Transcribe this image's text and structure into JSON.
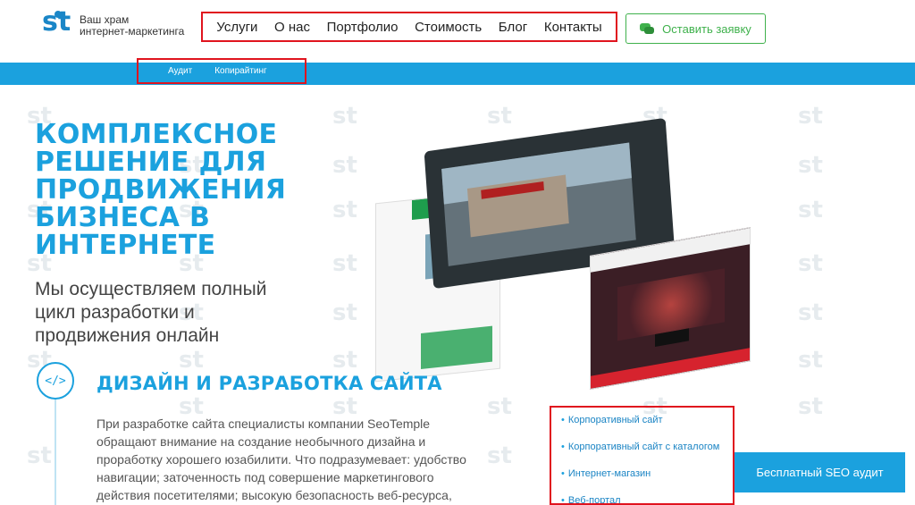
{
  "logo": {
    "line1": "Ваш храм",
    "line2": "интернет-маркетинга"
  },
  "nav": {
    "items": [
      {
        "label": "Услуги"
      },
      {
        "label": "О нас"
      },
      {
        "label": "Портфолио"
      },
      {
        "label": "Стоимость"
      },
      {
        "label": "Блог"
      },
      {
        "label": "Контакты"
      }
    ]
  },
  "cta_top": {
    "label": "Оставить заявку",
    "icon": "chat-bubbles-icon"
  },
  "subnav": {
    "items": [
      {
        "label": "Аудит"
      },
      {
        "label": "Копирайтинг"
      }
    ]
  },
  "hero": {
    "title": "КОМПЛЕКСНОЕ РЕШЕНИЕ ДЛЯ ПРОДВИЖЕНИЯ БИЗНЕСА В ИНТЕРНЕТЕ",
    "subtitle": "Мы осуществляем полный цикл разработки и продвижения онлайн"
  },
  "section": {
    "icon": "code-icon",
    "icon_text": "</>",
    "title": "ДИЗАЙН И РАЗРАБОТКА САЙТА",
    "text": "При разработке сайта специалисты компании SeoTemple обращают внимание на создание необычного дизайна и проработку хорошего юзабилити. Что подразумевает: удобство навигации; заточенность под совершение маркетингового действия посетителями; высокую безопасность веб-ресурса,"
  },
  "links": {
    "items": [
      {
        "label": "Корпоративный сайт"
      },
      {
        "label": "Корпоративный сайт с каталогом"
      },
      {
        "label": "Интернет-магазин"
      },
      {
        "label": "Веб-портал"
      }
    ]
  },
  "seo_button": {
    "label": "Бесплатный SEO аудит"
  },
  "colors": {
    "brand_blue": "#1ba1de",
    "green": "#3fb14c",
    "highlight_red": "#e0141e"
  }
}
